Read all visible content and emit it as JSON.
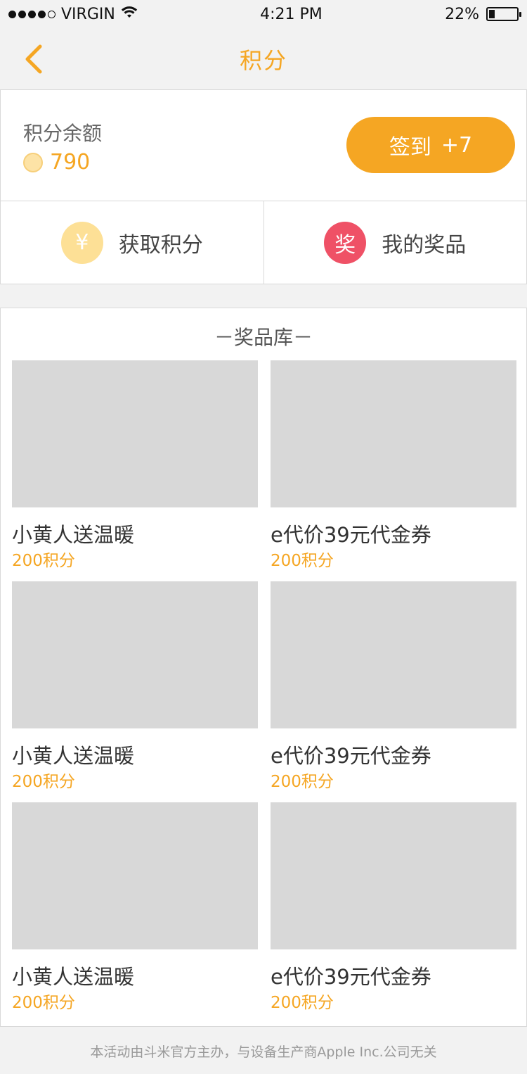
{
  "status_bar": {
    "carrier": "VIRGIN",
    "time": "4:21 PM",
    "battery": "22%",
    "battery_level": 0.22
  },
  "nav": {
    "title": "积分",
    "back_icon": "chevron-left-icon"
  },
  "balance": {
    "label": "积分余额",
    "value": "790",
    "signin_label": "签到",
    "signin_bonus": "+7"
  },
  "actions": [
    {
      "label": "获取积分",
      "icon_text": "¥",
      "icon": "yen-icon"
    },
    {
      "label": "我的奖品",
      "icon_text": "奖",
      "icon": "prize-icon"
    }
  ],
  "library": {
    "title": "－奖品库－",
    "items": [
      {
        "name": "小黄人送温暖",
        "points": "200积分"
      },
      {
        "name": "e代价39元代金券",
        "points": "200积分"
      },
      {
        "name": "小黄人送温暖",
        "points": "200积分"
      },
      {
        "name": "e代价39元代金券",
        "points": "200积分"
      },
      {
        "name": "小黄人送温暖",
        "points": "200积分"
      },
      {
        "name": "e代价39元代金券",
        "points": "200积分"
      }
    ]
  },
  "footer": {
    "text": "本活动由斗米官方主办，与设备生产商Apple Inc.公司无关"
  },
  "colors": {
    "accent": "#f5a623",
    "prize_icon": "#ef5166",
    "yen_icon": "#fde096"
  }
}
